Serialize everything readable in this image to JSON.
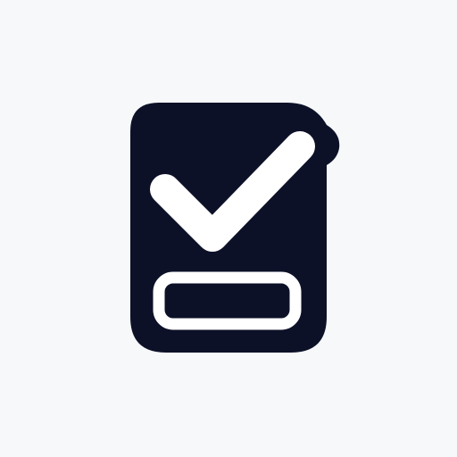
{
  "icon": {
    "name": "clipboard-check-icon",
    "colors": {
      "background": "#f6f8f9",
      "body": "#0d1128",
      "accent": "#ffffff"
    }
  }
}
